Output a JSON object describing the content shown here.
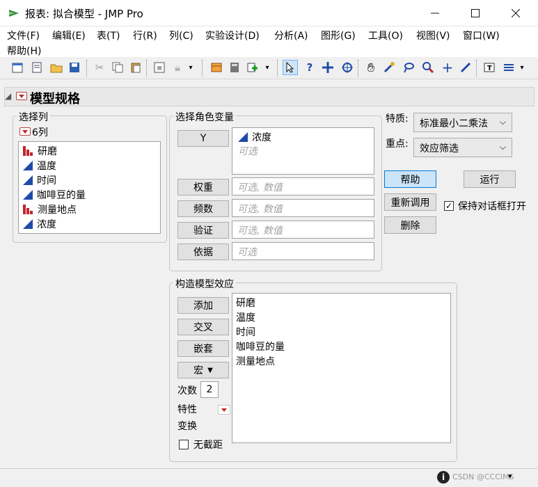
{
  "window": {
    "title": "报表: 拟合模型 - JMP Pro"
  },
  "menu": [
    "文件(F)",
    "编辑(E)",
    "表(T)",
    "行(R)",
    "列(C)",
    "实验设计(D)",
    "分析(A)",
    "图形(G)",
    "工具(O)",
    "视图(V)",
    "窗口(W)",
    "帮助(H)"
  ],
  "outline": {
    "title": "模型规格"
  },
  "select_columns": {
    "label": "选择列",
    "count": "6列",
    "items": [
      {
        "name": "研磨",
        "type": "nominal"
      },
      {
        "name": "温度",
        "type": "continuous"
      },
      {
        "name": "时间",
        "type": "continuous"
      },
      {
        "name": "咖啡豆的量",
        "type": "continuous"
      },
      {
        "name": "测量地点",
        "type": "nominal"
      },
      {
        "name": "浓度",
        "type": "continuous"
      }
    ]
  },
  "roles": {
    "label": "选择角色变量",
    "y_button": "Y",
    "y_value": "浓度",
    "y_placeholder": "可选",
    "weight_button": "权重",
    "weight_placeholder": "可选, 数值",
    "freq_button": "频数",
    "freq_placeholder": "可选, 数值",
    "validation_button": "验证",
    "validation_placeholder": "可选, 数值",
    "by_button": "依据",
    "by_placeholder": "可选"
  },
  "options": {
    "personality_label": "特质:",
    "personality_value": "标准最小二乘法",
    "emphasis_label": "重点:",
    "emphasis_value": "效应筛选",
    "help_button": "帮助",
    "run_button": "运行",
    "recall_button": "重新调用",
    "remove_button": "删除",
    "keep_open_label": "保持对话框打开",
    "keep_open_checked": true
  },
  "effects": {
    "label": "构造模型效应",
    "add_button": "添加",
    "cross_button": "交叉",
    "nest_button": "嵌套",
    "macros_button": "宏",
    "degree_label": "次数",
    "degree_value": "2",
    "attributes_label": "特性",
    "transform_label": "变换",
    "no_intercept_label": "无截距",
    "no_intercept_checked": false,
    "items": [
      "研磨",
      "温度",
      "时间",
      "咖啡豆的量",
      "测量地点"
    ]
  },
  "statusbar": {
    "watermark": "CSDN @CCCIMS"
  },
  "colors": {
    "nominal": "#c0262b",
    "continuous": "#1f4aa8",
    "accent": "#0078d7"
  }
}
